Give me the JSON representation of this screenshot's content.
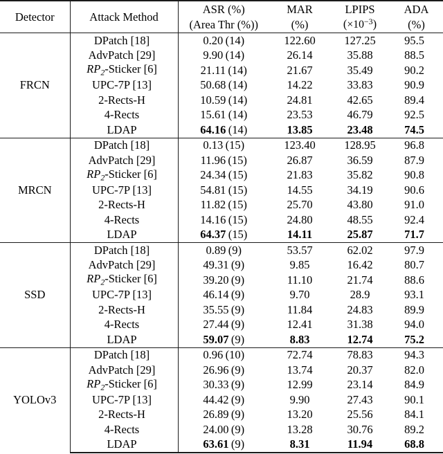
{
  "table": {
    "columns": [
      {
        "key": "detector",
        "line1": "Detector",
        "line2": ""
      },
      {
        "key": "method",
        "line1": "Attack Method",
        "line2": ""
      },
      {
        "key": "asr",
        "line1": "ASR (%)",
        "line2": "(Area Thr (%))"
      },
      {
        "key": "mar",
        "line1": "MAR",
        "line2": "(%)"
      },
      {
        "key": "lpips",
        "line1": "LPIPS",
        "line2": "(×10⁻³)"
      },
      {
        "key": "ada",
        "line1": "ADA",
        "line2": "(%)"
      }
    ],
    "header": {
      "detector": "Detector",
      "attack_method": "Attack Method",
      "asr_l1": "ASR (%)",
      "asr_l2": "(Area Thr (%))",
      "mar_l1": "MAR",
      "mar_l2": "(%)",
      "lpips_l1": "LPIPS",
      "lpips_l2_prefix": "(",
      "lpips_l2_times": "×10",
      "lpips_l2_exp": "−3",
      "lpips_l2_suffix": ")",
      "ada_l1": "ADA",
      "ada_l2": "(%)"
    },
    "method_labels": {
      "dpatch": "DPatch [18]",
      "advpatch": "AdvPatch [29]",
      "rp2_pre": "RP",
      "rp2_sub": "2",
      "rp2_post": "-Sticker [6]",
      "upc7p": "UPC-7P [13]",
      "rects2h": "2-Rects-H",
      "rects4": "4-Rects",
      "ldap": "LDAP"
    },
    "blocks": [
      {
        "detector": "FRCN",
        "rows": [
          {
            "method_key": "dpatch",
            "asr": "0.20",
            "thr": "(14)",
            "mar": "122.60",
            "lpips": "127.25",
            "ada": "95.5",
            "bold": false
          },
          {
            "method_key": "advpatch",
            "asr": "9.90",
            "thr": "(14)",
            "mar": "26.14",
            "lpips": "35.88",
            "ada": "88.5",
            "bold": false
          },
          {
            "method_key": "rp2",
            "asr": "21.11",
            "thr": "(14)",
            "mar": "21.67",
            "lpips": "35.49",
            "ada": "90.2",
            "bold": false
          },
          {
            "method_key": "upc7p",
            "asr": "50.68",
            "thr": "(14)",
            "mar": "14.22",
            "lpips": "33.83",
            "ada": "90.9",
            "bold": false
          },
          {
            "method_key": "rects2h",
            "asr": "10.59",
            "thr": "(14)",
            "mar": "24.81",
            "lpips": "42.65",
            "ada": "89.4",
            "bold": false
          },
          {
            "method_key": "rects4",
            "asr": "15.61",
            "thr": "(14)",
            "mar": "23.53",
            "lpips": "46.79",
            "ada": "92.5",
            "bold": false
          },
          {
            "method_key": "ldap",
            "asr": "64.16",
            "thr": "(14)",
            "mar": "13.85",
            "lpips": "23.48",
            "ada": "74.5",
            "bold": true
          }
        ]
      },
      {
        "detector": "MRCN",
        "rows": [
          {
            "method_key": "dpatch",
            "asr": "0.13",
            "thr": "(15)",
            "mar": "123.40",
            "lpips": "128.95",
            "ada": "96.8",
            "bold": false
          },
          {
            "method_key": "advpatch",
            "asr": "11.96",
            "thr": "(15)",
            "mar": "26.87",
            "lpips": "36.59",
            "ada": "87.9",
            "bold": false
          },
          {
            "method_key": "rp2",
            "asr": "24.34",
            "thr": "(15)",
            "mar": "21.83",
            "lpips": "35.82",
            "ada": "90.8",
            "bold": false
          },
          {
            "method_key": "upc7p",
            "asr": "54.81",
            "thr": "(15)",
            "mar": "14.55",
            "lpips": "34.19",
            "ada": "90.6",
            "bold": false
          },
          {
            "method_key": "rects2h",
            "asr": "11.82",
            "thr": "(15)",
            "mar": "25.70",
            "lpips": "43.80",
            "ada": "91.0",
            "bold": false
          },
          {
            "method_key": "rects4",
            "asr": "14.16",
            "thr": "(15)",
            "mar": "24.80",
            "lpips": "48.55",
            "ada": "92.4",
            "bold": false
          },
          {
            "method_key": "ldap",
            "asr": "64.37",
            "thr": "(15)",
            "mar": "14.11",
            "lpips": "25.87",
            "ada": "71.7",
            "bold": true
          }
        ]
      },
      {
        "detector": "SSD",
        "rows": [
          {
            "method_key": "dpatch",
            "asr": "0.89",
            "thr": "(9)",
            "mar": "53.57",
            "lpips": "62.02",
            "ada": "97.9",
            "bold": false
          },
          {
            "method_key": "advpatch",
            "asr": "49.31",
            "thr": "(9)",
            "mar": "9.85",
            "lpips": "16.42",
            "ada": "80.7",
            "bold": false
          },
          {
            "method_key": "rp2",
            "asr": "39.20",
            "thr": "(9)",
            "mar": "11.10",
            "lpips": "21.74",
            "ada": "88.6",
            "bold": false
          },
          {
            "method_key": "upc7p",
            "asr": "46.14",
            "thr": "(9)",
            "mar": "9.70",
            "lpips": "28.9",
            "ada": "93.1",
            "bold": false
          },
          {
            "method_key": "rects2h",
            "asr": "35.55",
            "thr": "(9)",
            "mar": "11.84",
            "lpips": "24.83",
            "ada": "89.9",
            "bold": false
          },
          {
            "method_key": "rects4",
            "asr": "27.44",
            "thr": "(9)",
            "mar": "12.41",
            "lpips": "31.38",
            "ada": "94.0",
            "bold": false
          },
          {
            "method_key": "ldap",
            "asr": "59.07",
            "thr": "(9)",
            "mar": "8.83",
            "lpips": "12.74",
            "ada": "75.2",
            "bold": true
          }
        ]
      },
      {
        "detector": "YOLOv3",
        "rows": [
          {
            "method_key": "dpatch",
            "asr": "0.96",
            "thr": "(10)",
            "mar": "72.74",
            "lpips": "78.83",
            "ada": "94.3",
            "bold": false
          },
          {
            "method_key": "advpatch",
            "asr": "26.96",
            "thr": "(9)",
            "mar": "13.74",
            "lpips": "20.37",
            "ada": "82.0",
            "bold": false
          },
          {
            "method_key": "rp2",
            "asr": "30.33",
            "thr": "(9)",
            "mar": "12.99",
            "lpips": "23.14",
            "ada": "84.9",
            "bold": false
          },
          {
            "method_key": "upc7p",
            "asr": "44.42",
            "thr": "(9)",
            "mar": "9.90",
            "lpips": "27.43",
            "ada": "90.1",
            "bold": false
          },
          {
            "method_key": "rects2h",
            "asr": "26.89",
            "thr": "(9)",
            "mar": "13.20",
            "lpips": "25.56",
            "ada": "84.1",
            "bold": false
          },
          {
            "method_key": "rects4",
            "asr": "24.00",
            "thr": "(9)",
            "mar": "13.28",
            "lpips": "30.76",
            "ada": "89.2",
            "bold": false
          },
          {
            "method_key": "ldap",
            "asr": "63.61",
            "thr": "(9)",
            "mar": "8.31",
            "lpips": "11.94",
            "ada": "68.8",
            "bold": true
          }
        ]
      }
    ]
  }
}
